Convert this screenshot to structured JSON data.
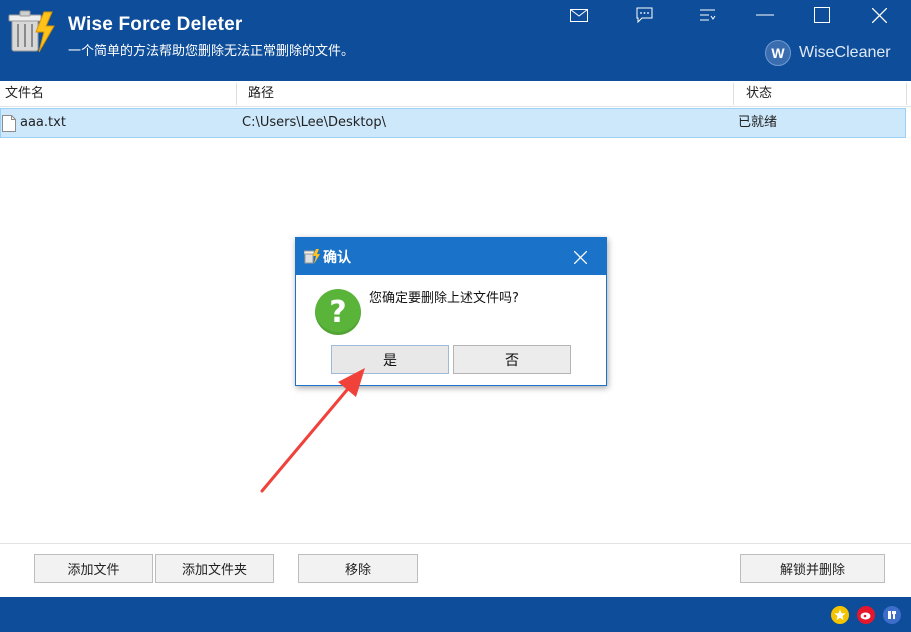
{
  "app": {
    "title": "Wise Force Deleter",
    "subtitle": "一个简单的方法帮助您删除无法正常删除的文件。",
    "brand_letter": "W",
    "brand_name": "WiseCleaner"
  },
  "window_controls": [
    "mail-icon",
    "feedback-icon",
    "menu-icon",
    "minimize-icon",
    "maximize-icon",
    "close-icon"
  ],
  "table": {
    "columns": [
      "文件名",
      "路径",
      "状态"
    ],
    "rows": [
      {
        "name": "aaa.txt",
        "path": "C:\\Users\\Lee\\Desktop\\",
        "status": "已就绪"
      }
    ]
  },
  "toolbar": {
    "add_file": "添加文件",
    "add_folder": "添加文件夹",
    "remove": "移除",
    "unlock_delete": "解锁并删除"
  },
  "dialog": {
    "title": "确认",
    "message": "您确定要删除上述文件吗?",
    "yes": "是",
    "no": "否"
  },
  "footer_icons": [
    "star-icon",
    "weibo-icon",
    "tieba-icon"
  ],
  "colors": {
    "header_bg": "#0e4d99",
    "dialog_titlebar": "#1a73c8",
    "row_selected": "#cde8fb",
    "question_green": "#5ab43a",
    "annotation_arrow": "#f0413a"
  }
}
